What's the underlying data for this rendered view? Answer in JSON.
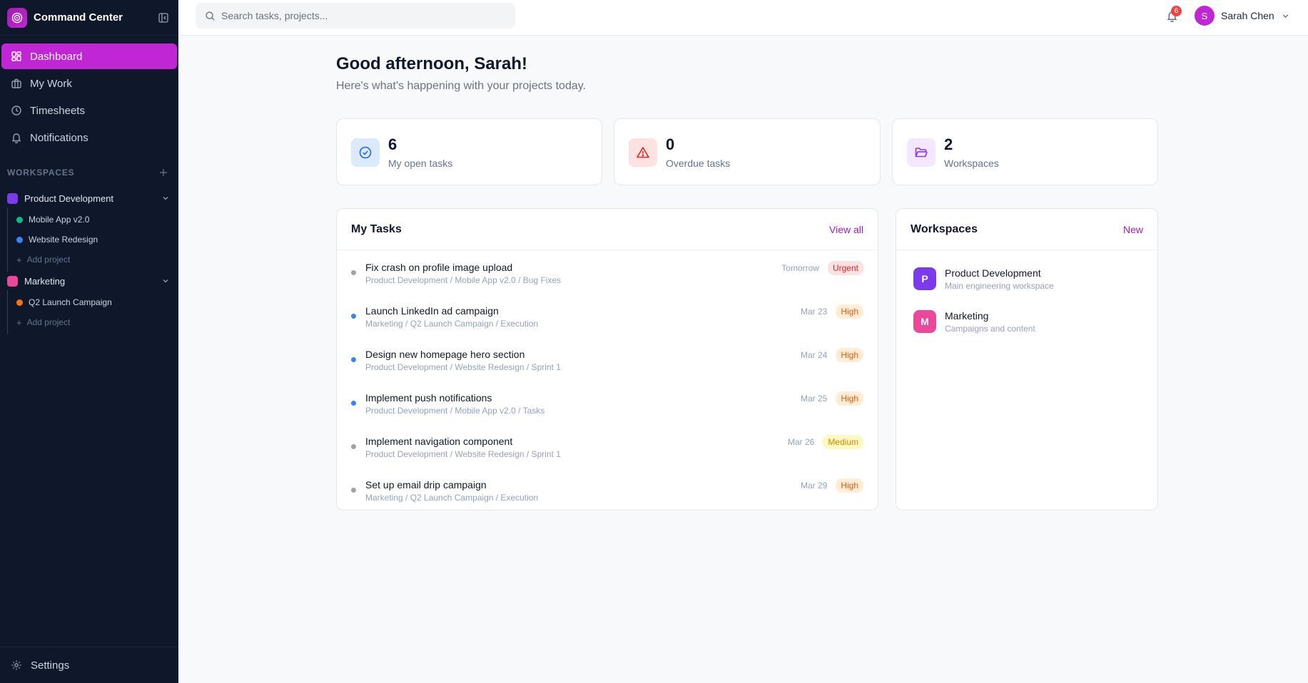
{
  "app": {
    "title": "Command Center"
  },
  "nav": [
    {
      "label": "Dashboard",
      "icon": "dashboard-grid-icon",
      "active": true
    },
    {
      "label": "My Work",
      "icon": "briefcase-icon"
    },
    {
      "label": "Timesheets",
      "icon": "clock-icon"
    },
    {
      "label": "Notifications",
      "icon": "bell-icon"
    }
  ],
  "sidebar": {
    "workspaces_heading": "WORKSPACES",
    "workspaces": [
      {
        "name": "Product Development",
        "color": "#7c3aed",
        "projects": [
          {
            "name": "Mobile App v2.0",
            "color": "#10b981"
          },
          {
            "name": "Website Redesign",
            "color": "#3b82f6"
          }
        ],
        "add_label": "Add project"
      },
      {
        "name": "Marketing",
        "color": "#ec4899",
        "projects": [
          {
            "name": "Q2 Launch Campaign",
            "color": "#f97316"
          }
        ],
        "add_label": "Add project"
      }
    ],
    "settings_label": "Settings"
  },
  "topbar": {
    "search_placeholder": "Search tasks, projects...",
    "notification_count": "6",
    "user_initial": "S",
    "user_name": "Sarah Chen"
  },
  "main": {
    "greeting": "Good afternoon, Sarah!",
    "subtitle": "Here's what's happening with your projects today.",
    "stats": [
      {
        "value": "6",
        "label": "My open tasks",
        "icon": "check-circle-icon",
        "bg": "#dbeafe",
        "fg": "#2563eb"
      },
      {
        "value": "0",
        "label": "Overdue tasks",
        "icon": "alert-triangle-icon",
        "bg": "#fee2e2",
        "fg": "#dc2626"
      },
      {
        "value": "2",
        "label": "Workspaces",
        "icon": "folder-open-icon",
        "bg": "#f3e8ff",
        "fg": "#9333ea"
      }
    ],
    "tasks_card": {
      "title": "My Tasks",
      "link": "View all",
      "tasks": [
        {
          "title": "Fix crash on profile image upload",
          "path": "Product Development / Mobile App v2.0 / Bug Fixes",
          "due": "Tomorrow",
          "priority": "Urgent",
          "dot": "#9ca3af"
        },
        {
          "title": "Launch LinkedIn ad campaign",
          "path": "Marketing / Q2 Launch Campaign / Execution",
          "due": "Mar 23",
          "priority": "High",
          "dot": "#3b82f6"
        },
        {
          "title": "Design new homepage hero section",
          "path": "Product Development / Website Redesign / Sprint 1",
          "due": "Mar 24",
          "priority": "High",
          "dot": "#3b82f6"
        },
        {
          "title": "Implement push notifications",
          "path": "Product Development / Mobile App v2.0 / Tasks",
          "due": "Mar 25",
          "priority": "High",
          "dot": "#3b82f6"
        },
        {
          "title": "Implement navigation component",
          "path": "Product Development / Website Redesign / Sprint 1",
          "due": "Mar 26",
          "priority": "Medium",
          "dot": "#9ca3af"
        },
        {
          "title": "Set up email drip campaign",
          "path": "Marketing / Q2 Launch Campaign / Execution",
          "due": "Mar 29",
          "priority": "High",
          "dot": "#9ca3af"
        }
      ]
    },
    "workspaces_card": {
      "title": "Workspaces",
      "link": "New",
      "items": [
        {
          "initial": "P",
          "name": "Product Development",
          "desc": "Main engineering workspace",
          "color": "#7c3aed"
        },
        {
          "initial": "M",
          "name": "Marketing",
          "desc": "Campaigns and content",
          "color": "#ec4899"
        }
      ]
    }
  }
}
